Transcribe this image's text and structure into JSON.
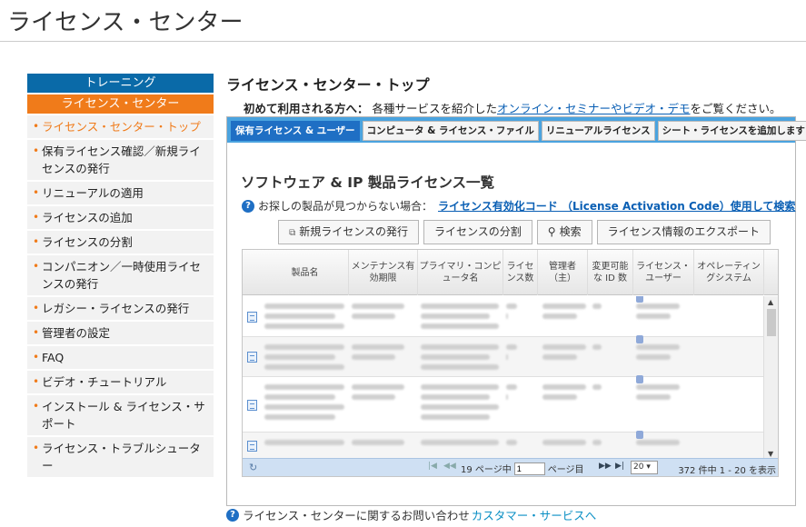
{
  "app_title": "ライセンス・センター",
  "sidebar": {
    "head1": "トレーニング",
    "head2": "ライセンス・センター",
    "items": [
      {
        "label": "ライセンス・センター・トップ",
        "active": true
      },
      {
        "label": "保有ライセンス確認／新規ライセンスの発行"
      },
      {
        "label": "リニューアルの適用"
      },
      {
        "label": "ライセンスの追加"
      },
      {
        "label": "ライセンスの分割"
      },
      {
        "label": "コンパニオン／一時使用ライセンスの発行"
      },
      {
        "label": "レガシー・ライセンスの発行"
      },
      {
        "label": "管理者の設定"
      },
      {
        "label": "FAQ"
      },
      {
        "label": "ビデオ・チュートリアル"
      },
      {
        "label": "インストール & ライセンス・サポート"
      },
      {
        "label": "ライセンス・トラブルシューター"
      }
    ]
  },
  "main": {
    "title": "ライセンス・センター・トップ",
    "intro_bold": "初めて利用される方へ：",
    "intro_text": "各種サービスを紹介した",
    "intro_link": "オンライン・セミナーやビデオ・デモ",
    "intro_tail": "をご覧ください。"
  },
  "tabs": [
    {
      "label": "保有ライセンス & ユーザー",
      "active": true
    },
    {
      "label": "コンピュータ & ライセンス・ファイル"
    },
    {
      "label": "リニューアルライセンス"
    },
    {
      "label": "シート・ライセンスを追加します"
    }
  ],
  "section": {
    "title": "ソフトウェア & IP 製品ライセンス一覧",
    "hint_text": "お探しの製品が見つからない場合：",
    "hint_link": "ライセンス有効化コード （License Activation Code）使用して検索"
  },
  "buttons": {
    "new_license": "新規ライセンスの発行",
    "split": "ライセンスの分割",
    "search": "検索",
    "export": "ライセンス情報のエクスポート"
  },
  "grid": {
    "columns": [
      {
        "label": "製品名"
      },
      {
        "label": "メンテナンス有効期限"
      },
      {
        "label": "プライマリ・コンピュータ名"
      },
      {
        "label": "ライセンス数"
      },
      {
        "label": "管理者（主）"
      },
      {
        "label": "変更可能な ID 数"
      },
      {
        "label": "ライセンス・ユーザー"
      },
      {
        "label": "オペレーティングシステム"
      }
    ]
  },
  "pager": {
    "page_prefix": "19 ページ中",
    "page_value": "1",
    "page_suffix": "ページ目",
    "page_size": "20",
    "count": "372 件中 1 - 20 を表示"
  },
  "footer": {
    "text": "ライセンス・センターに関するお問い合わせ",
    "link": "カスタマー・サービスへ"
  }
}
